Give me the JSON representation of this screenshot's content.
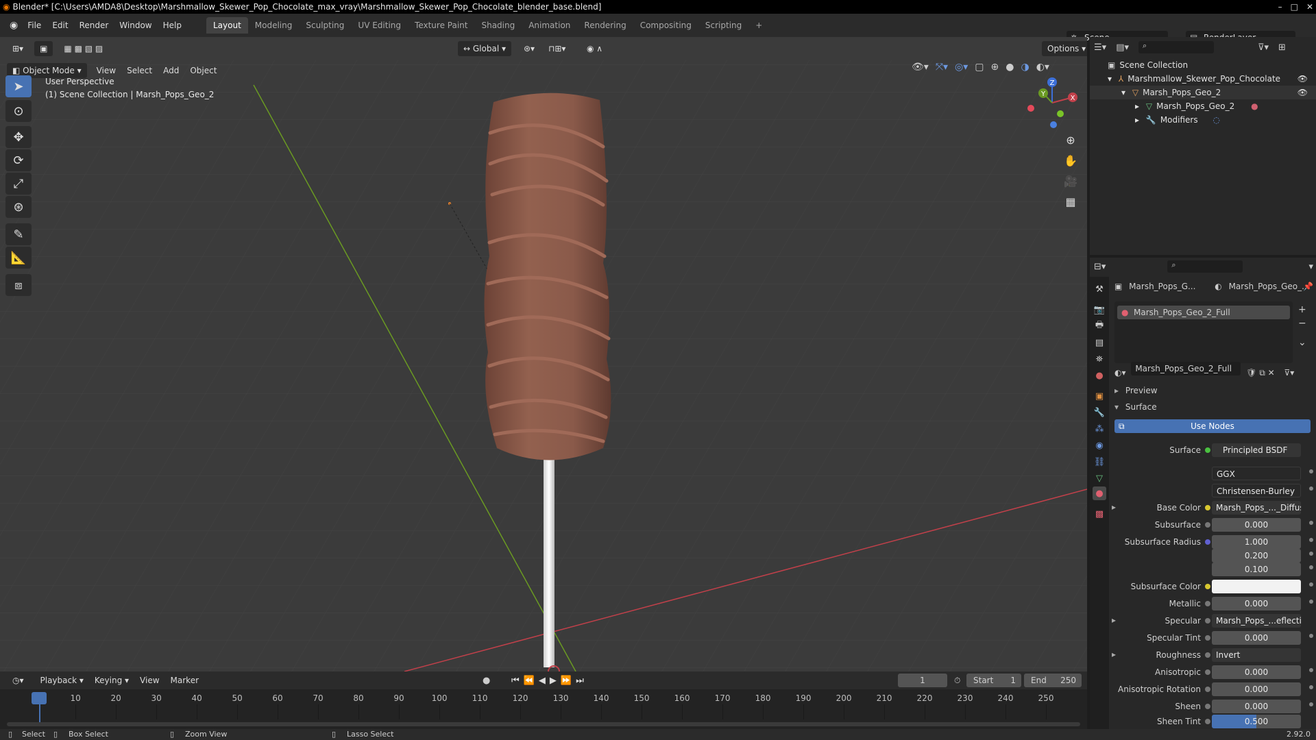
{
  "window": {
    "title": "Blender* [C:\\Users\\AMDA8\\Desktop\\Marshmallow_Skewer_Pop_Chocolate_max_vray\\Marshmallow_Skewer_Pop_Chocolate_blender_base.blend]",
    "buttons": [
      "–",
      "□",
      "✕"
    ]
  },
  "menubar": {
    "menus": [
      "File",
      "Edit",
      "Render",
      "Window",
      "Help"
    ],
    "workspaces": [
      "Layout",
      "Modeling",
      "Sculpting",
      "UV Editing",
      "Texture Paint",
      "Shading",
      "Animation",
      "Rendering",
      "Compositing",
      "Scripting"
    ],
    "active_workspace": "Layout",
    "add_tab": "+",
    "scene": "Scene",
    "view_layer": "RenderLayer"
  },
  "viewport": {
    "mode": "Object Mode",
    "menus": [
      "View",
      "Select",
      "Add",
      "Object"
    ],
    "transform_orientation": "Global",
    "options_label": "Options",
    "perspective": "User Perspective",
    "collection_info": "(1) Scene Collection | Marsh_Pops_Geo_2",
    "gizmo_axes": [
      "X",
      "Y",
      "Z"
    ]
  },
  "outliner": {
    "root": "Scene Collection",
    "items": [
      {
        "label": "Marshmallow_Skewer_Pop_Chocolate"
      },
      {
        "label": "Marsh_Pops_Geo_2"
      },
      {
        "label": "Marsh_Pops_Geo_2"
      },
      {
        "label": "Modifiers"
      }
    ]
  },
  "properties": {
    "breadcrumb_object": "Marsh_Pops_G...",
    "breadcrumb_material": "Marsh_Pops_Geo_...",
    "material_slot": "Marsh_Pops_Geo_2_Full",
    "material_name": "Marsh_Pops_Geo_2_Full",
    "panels": {
      "preview": "Preview",
      "surface": "Surface"
    },
    "use_nodes": "Use Nodes",
    "rows": [
      {
        "label": "Surface",
        "value": "Principled BSDF"
      },
      {
        "label": "",
        "value": "GGX"
      },
      {
        "label": "",
        "value": "Christensen-Burley"
      },
      {
        "label": "Base Color",
        "value": "Marsh_Pops_..._Diffuse.png"
      },
      {
        "label": "Subsurface",
        "value": "0.000"
      },
      {
        "label": "Subsurface Radius",
        "value": "1.000"
      },
      {
        "label": "",
        "value": "0.200"
      },
      {
        "label": "",
        "value": "0.100"
      },
      {
        "label": "Subsurface Color",
        "value": ""
      },
      {
        "label": "Metallic",
        "value": "0.000"
      },
      {
        "label": "Specular",
        "value": "Marsh_Pops_...eflection.png"
      },
      {
        "label": "Specular Tint",
        "value": "0.000"
      },
      {
        "label": "Roughness",
        "value": "Invert"
      },
      {
        "label": "Anisotropic",
        "value": "0.000"
      },
      {
        "label": "Anisotropic Rotation",
        "value": "0.000"
      },
      {
        "label": "Sheen",
        "value": "0.000"
      },
      {
        "label": "Sheen Tint",
        "value": "0.500"
      }
    ]
  },
  "timeline": {
    "menus": [
      "Playback",
      "Keying",
      "View",
      "Marker"
    ],
    "current_frame": "1",
    "start_label": "Start",
    "start": "1",
    "end_label": "End",
    "end": "250",
    "ticks": [
      "1",
      "10",
      "20",
      "30",
      "40",
      "50",
      "60",
      "70",
      "80",
      "90",
      "100",
      "110",
      "120",
      "130",
      "140",
      "150",
      "160",
      "170",
      "180",
      "190",
      "200",
      "210",
      "220",
      "230",
      "240",
      "250"
    ]
  },
  "statusbar": {
    "select": "Select",
    "box_select": "Box Select",
    "zoom_view": "Zoom View",
    "lasso_select": "Lasso Select",
    "version": "2.92.0"
  },
  "colors": {
    "accent": "#4772b3",
    "chocolate": "#8a5a4c",
    "x_axis": "#c2404a",
    "y_axis": "#6a9a22",
    "z_axis": "#3c6fd8"
  }
}
